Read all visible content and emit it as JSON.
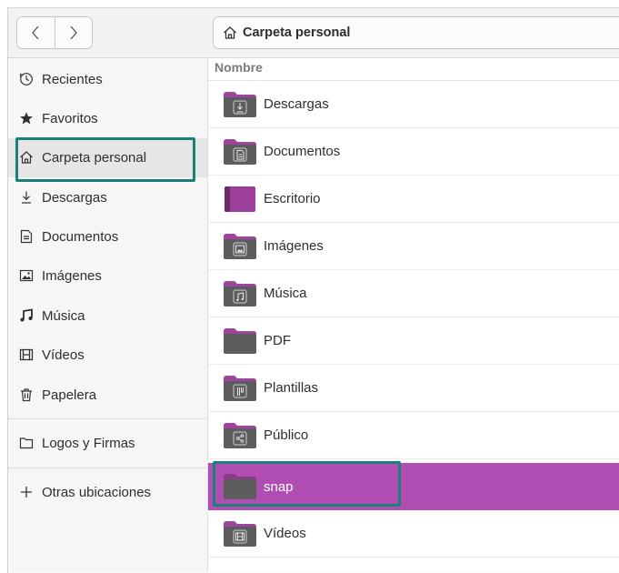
{
  "window": {
    "nav": {
      "back_icon": "chevron-left-icon",
      "forward_icon": "chevron-right-icon"
    },
    "path": {
      "icon": "home-icon",
      "label": "Carpeta personal"
    }
  },
  "sidebar": {
    "items": [
      {
        "label": "Recientes",
        "icon": "clock-icon"
      },
      {
        "label": "Favoritos",
        "icon": "star-icon"
      },
      {
        "label": "Carpeta personal",
        "icon": "home-icon",
        "active": true,
        "highlighted": true
      },
      {
        "label": "Descargas",
        "icon": "download-icon"
      },
      {
        "label": "Documentos",
        "icon": "document-icon"
      },
      {
        "label": "Imágenes",
        "icon": "image-icon"
      },
      {
        "label": "Música",
        "icon": "music-icon"
      },
      {
        "label": "Vídeos",
        "icon": "film-icon"
      },
      {
        "label": "Papelera",
        "icon": "trash-icon"
      },
      {
        "label": "Logos y Firmas",
        "icon": "folder-icon"
      },
      {
        "label": "Otras ubicaciones",
        "icon": "plus-icon"
      }
    ]
  },
  "list": {
    "column_header": "Nombre",
    "files": [
      {
        "name": "Descargas",
        "icon": "folder-download-icon"
      },
      {
        "name": "Documentos",
        "icon": "folder-documents-icon"
      },
      {
        "name": "Escritorio",
        "icon": "folder-desktop-icon"
      },
      {
        "name": "Imágenes",
        "icon": "folder-pictures-icon"
      },
      {
        "name": "Música",
        "icon": "folder-music-icon"
      },
      {
        "name": "PDF",
        "icon": "folder-generic-icon"
      },
      {
        "name": "Plantillas",
        "icon": "folder-templates-icon"
      },
      {
        "name": "Público",
        "icon": "folder-public-icon"
      },
      {
        "name": "snap",
        "icon": "folder-generic-icon",
        "selected": true,
        "highlighted": true
      },
      {
        "name": "Vídeos",
        "icon": "folder-videos-icon"
      }
    ]
  },
  "colors": {
    "accent_purple": "#b04eb3",
    "highlight_teal": "#1a8078",
    "folder_purple": "#a0449f",
    "folder_gray": "#5d5d5d"
  }
}
